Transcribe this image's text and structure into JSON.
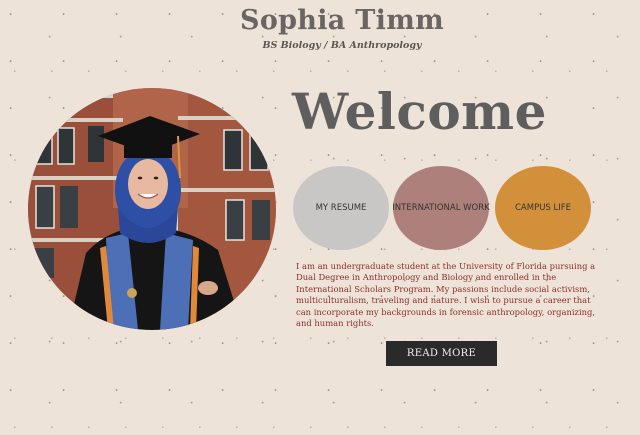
{
  "header": {
    "name": "Sophia Timm",
    "degrees": "BS Biology / BA Anthropology"
  },
  "hero": {
    "welcome": "Welcome",
    "photo_icon": "graduate-portrait"
  },
  "nav": {
    "items": [
      {
        "label": "MY RESUME",
        "color": "#c9c7c6"
      },
      {
        "label": "INTERNATIONAL WORK",
        "color": "#ae807c"
      },
      {
        "label": "CAMPUS LIFE",
        "color": "#d2903a"
      }
    ]
  },
  "bio": {
    "text": "I am an undergraduate student at the University of Florida pursuing a Dual Degree in Anthropology and Biology and enrolled in the International Scholars Program. My passions include social activism, multiculturalism, traveling and nature. I wish to pursue a career that can incorporate my backgrounds in forensic anthropology, organizing, and human rights."
  },
  "cta": {
    "label": "READ MORE",
    "color": "#2a2a2a"
  },
  "theme": {
    "background": "#ede3d9",
    "text_accent": "#8e2f2b"
  }
}
